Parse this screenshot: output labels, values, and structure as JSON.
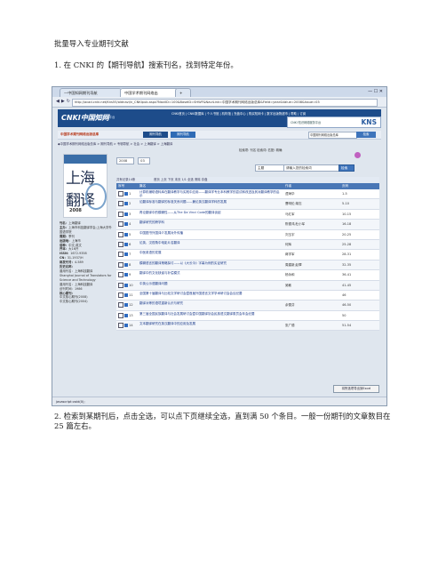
{
  "heading": "批量导入专业期刊文献",
  "step1": "1. 在 CNKI 的【期刊导航】搜索刊名，找到特定年份。",
  "step2": "2. 检索到某期刊后，点击全选，可以点下页继续全选，直到满 50 个条目。一般一份期刊的文章数目在 25 篇左右。",
  "browser": {
    "tab1": "—中国知网期刊导航",
    "tab2": "中国学术期刊网络出",
    "url": "http://acad.cnki.net/Kns55/oldnavi/n_CNKIpub.aspx?NaviID=100&BaseID=SHWF&NaviLink=中国学术期刊网络出版总库&Field=year&Value=2008&Issue=03",
    "status": "javascript:void(0);"
  },
  "cnki": {
    "logo": "CNKI中国知网",
    "logo_sub": "CNKI 知识网络服务平台",
    "top_links": "CNKI首页 | CNKI数据库 | 个人书馆 | 机构馆 | 充值中心 | 购买知网卡 | 数字出版物超市 | 帮助 | 订阅",
    "kns_sub": "CNKI 知识网络服务平台",
    "kns": "KNS",
    "site_name": "中国学术期刊网络出版总库",
    "nav_tab1": "期刊导航",
    "nav_tab2": "期刊导航",
    "search_select": "中国期刊网络出版总库",
    "search_btn": "检索",
    "breadcrumb": "◆中国学术期刊网络出版总库 > 期刊导航 > 专辑导航 > 社会 > 上海翻译 > 上海翻译",
    "search_labels": "检索项: 刊名   检索词:   匹配: 精确"
  },
  "journal": {
    "cover_band": "SHANGHAI JOURNAL OF TRANSLATORS",
    "cover_title": "上海翻译",
    "cover_year": "2008",
    "year": "2008",
    "issue": "03",
    "field": "主题",
    "query": "请输入您的检索词",
    "go": "检索"
  },
  "sidebar": [
    {
      "k": "刊名：",
      "v": "上海翻译"
    },
    {
      "k": "主办：",
      "v": "上海市科技翻译学会;上海大学外国语学院"
    },
    {
      "k": "周期：",
      "v": "季刊"
    },
    {
      "k": "出版地：",
      "v": "上海市"
    },
    {
      "k": "语种：",
      "v": "中文;英文"
    },
    {
      "k": "开本：",
      "v": "大16开"
    },
    {
      "k": "ISSN：",
      "v": "1672-9358"
    },
    {
      "k": "CN：",
      "v": "31-1937/H"
    },
    {
      "k": "邮发代号：",
      "v": "4-589"
    },
    {
      "k": "历史名称：",
      "v": ""
    },
    {
      "k": "",
      "v": "曾用刊名：上海科技翻译"
    },
    {
      "k": "",
      "v": "Shanghai Journal of Translators for Science and Technology"
    },
    {
      "k": "",
      "v": "曾用刊名：上海科技翻译"
    },
    {
      "k": "",
      "v": "创刊时间：1986"
    },
    {
      "k": "核心期刊：",
      "v": ""
    },
    {
      "k": "",
      "v": "中文核心期刊(2008)"
    },
    {
      "k": "",
      "v": "中文核心期刊(2004)"
    }
  ],
  "results": {
    "toolbar": "共有记录14条",
    "toolbar_nav": "首页  上页  下页  末页  1/1  全选  清除  存盘",
    "headers": {
      "no": "序号",
      "title": "篇名",
      "author": "作者",
      "page": "页码"
    },
    "rows": [
      {
        "no": "1",
        "title": "计算机辅助语料库在翻译教学与实践中应用——翻译学专业本科教学的尝试和改进及其对翻译教学的启示",
        "author": "谭海华",
        "page": "1-5"
      },
      {
        "no": "2",
        "title": "论翻译标准与翻译的标准关系问题——兼论英汉翻译学科的发展",
        "author": "曹明伦;胡志",
        "page": "5-10"
      },
      {
        "no": "3",
        "title": "再论翻译中的模糊性——从The Da Vinci Code的翻译谈起",
        "author": "马红军",
        "page": "10-15"
      },
      {
        "no": "4",
        "title": "翻译研究的跨学科",
        "author": "陈德鸿;杜小军",
        "page": "16-18"
      },
      {
        "no": "5",
        "title": "中国图书外国译介发展对外传播",
        "author": "刘玉宇",
        "page": "20-25"
      },
      {
        "no": "6",
        "title": "论英、汉视角中电影片名翻译",
        "author": "何辉",
        "page": "25-28"
      },
      {
        "no": "7",
        "title": "中医英语的发展",
        "author": "蒋学军",
        "page": "28-31"
      },
      {
        "no": "8",
        "title": "模糊语言的翻译策略探讨——以《大长今》字幕为例的实证研究",
        "author": "周建新;赵翠",
        "page": "32-35"
      },
      {
        "no": "9",
        "title": "翻译中的文化缺省与补偿模式",
        "author": "杨永和",
        "page": "36-41"
      },
      {
        "no": "10",
        "title": "中英公示语翻译问题",
        "author": "吴敏",
        "page": "41-45"
      },
      {
        "no": "11",
        "title": "全国第十届翻译与比较文学研讨会暨首届外国语言文学学术研讨会会议纪要",
        "author": "",
        "page": "46"
      },
      {
        "no": "12",
        "title": "翻译对等的语境重新认识与研究",
        "author": "余雪芬",
        "page": "46-50"
      },
      {
        "no": "13",
        "title": "第三届全国民族翻译与社会发展研讨会暨中国翻译协会民族语文翻译委员会年会纪要",
        "author": "",
        "page": "50"
      },
      {
        "no": "14",
        "title": "文本翻译研究在英汉翻译中的应用及发展",
        "author": "张广德",
        "page": "51-54"
      }
    ],
    "download": "将所选项导出到Excel"
  }
}
